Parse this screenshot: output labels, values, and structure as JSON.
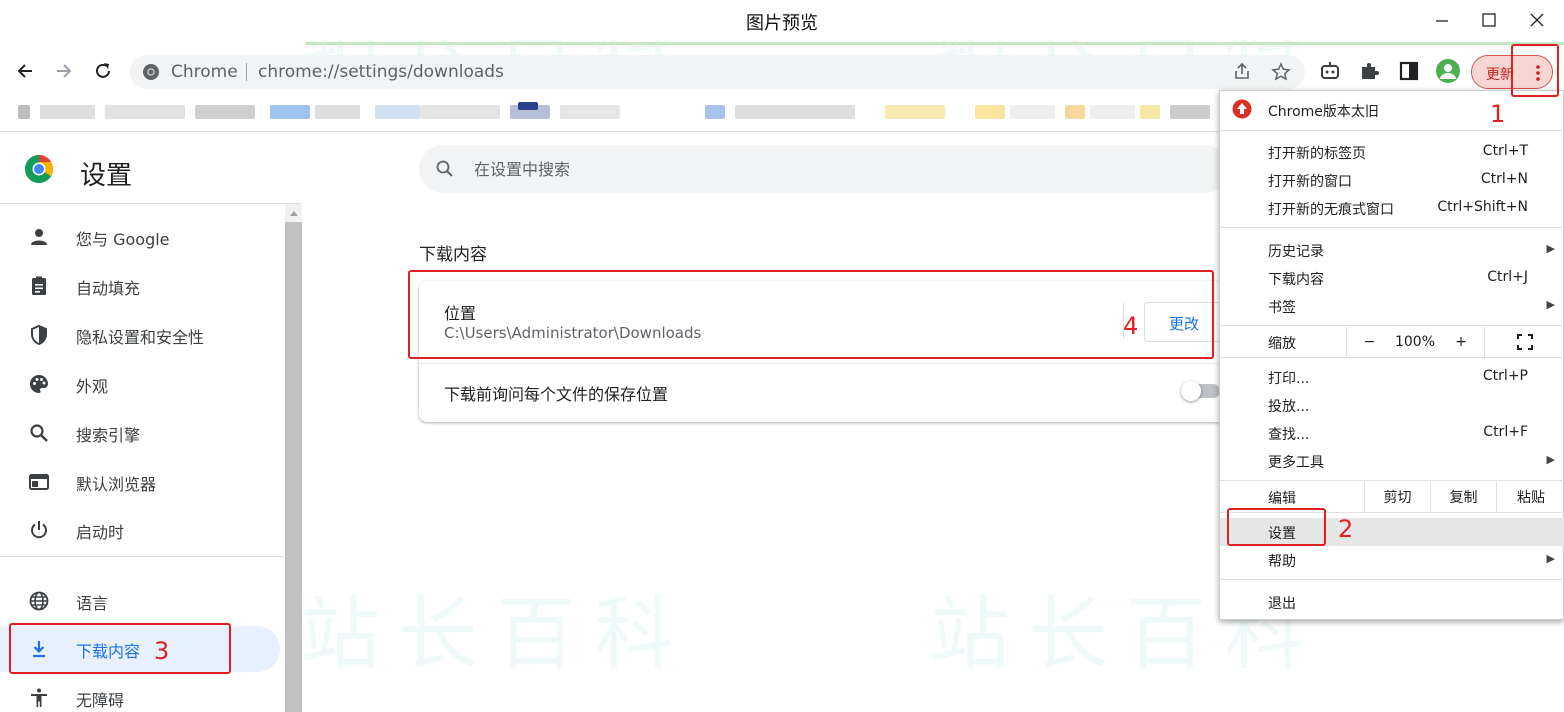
{
  "window": {
    "title": "图片预览"
  },
  "toolbar": {
    "omnibox_prefix": "Chrome",
    "url": "chrome://settings/downloads",
    "update_label": "更新"
  },
  "sidebar": {
    "title": "设置",
    "items": [
      {
        "label": "您与 Google",
        "icon": "person-icon"
      },
      {
        "label": "自动填充",
        "icon": "clipboard-icon"
      },
      {
        "label": "隐私设置和安全性",
        "icon": "shield-icon"
      },
      {
        "label": "外观",
        "icon": "palette-icon"
      },
      {
        "label": "搜索引擎",
        "icon": "search-icon"
      },
      {
        "label": "默认浏览器",
        "icon": "browser-icon"
      },
      {
        "label": "启动时",
        "icon": "power-icon"
      },
      {
        "label": "语言",
        "icon": "globe-icon"
      },
      {
        "label": "下载内容",
        "icon": "download-icon",
        "active": true
      },
      {
        "label": "无障碍",
        "icon": "accessibility-icon"
      }
    ]
  },
  "main": {
    "search_placeholder": "在设置中搜索",
    "section_title": "下载内容",
    "location_label": "位置",
    "location_path": "C:\\Users\\Administrator\\Downloads",
    "change_button": "更改",
    "ask_label": "下载前询问每个文件的保存位置",
    "ask_enabled": false
  },
  "menu": {
    "update_notice": "Chrome版本太旧",
    "new_tab": "打开新的标签页",
    "new_tab_key": "Ctrl+T",
    "new_window": "打开新的窗口",
    "new_window_key": "Ctrl+N",
    "incognito": "打开新的无痕式窗口",
    "incognito_key": "Ctrl+Shift+N",
    "history": "历史记录",
    "downloads": "下载内容",
    "downloads_key": "Ctrl+J",
    "bookmarks": "书签",
    "zoom": "缩放",
    "zoom_minus": "−",
    "zoom_value": "100%",
    "zoom_plus": "+",
    "print": "打印...",
    "print_key": "Ctrl+P",
    "cast": "投放...",
    "find": "查找...",
    "find_key": "Ctrl+F",
    "more_tools": "更多工具",
    "edit": "编辑",
    "cut": "剪切",
    "copy": "复制",
    "paste": "粘贴",
    "settings": "设置",
    "help": "帮助",
    "exit": "退出"
  },
  "annotations": {
    "n1": "1",
    "n2": "2",
    "n3": "3",
    "n4": "4"
  },
  "colors": {
    "accent": "#1a73e8",
    "annotation": "#e02020",
    "update_bg": "#f6d6d3"
  }
}
